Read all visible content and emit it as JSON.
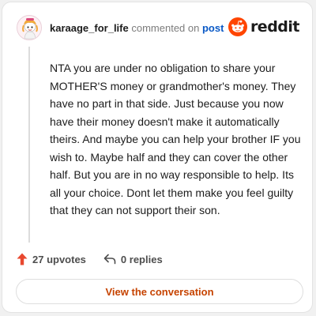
{
  "header": {
    "username": "karaage_for_life",
    "action_text": "commented on",
    "post_link_label": "post",
    "brand": "reddit"
  },
  "comment": {
    "body": "NTA you are under no obligation to share your MOTHER'S money or grandmother's money. They have no part in that side. Just because you now have their money doesn't make it automatically theirs. And maybe you can help your brother IF you wish to. Maybe half and they can cover the other half. But you are in no way responsible to help. Its all your choice. Dont let them make you feel guilty that they can not support their son."
  },
  "actions": {
    "upvotes_label": "27 upvotes",
    "replies_label": "0 replies"
  },
  "cta": {
    "label": "View the conversation"
  },
  "colors": {
    "reddit_orange": "#ff4500",
    "upvote_arrow": "#e8482f",
    "link_blue": "#0a59c6",
    "cta_text": "#c64300"
  },
  "icons": {
    "avatar": "snoo-avatar",
    "upvote": "upvote-arrow-icon",
    "reply": "reply-arrow-icon",
    "logo": "reddit-snoo-logo"
  }
}
